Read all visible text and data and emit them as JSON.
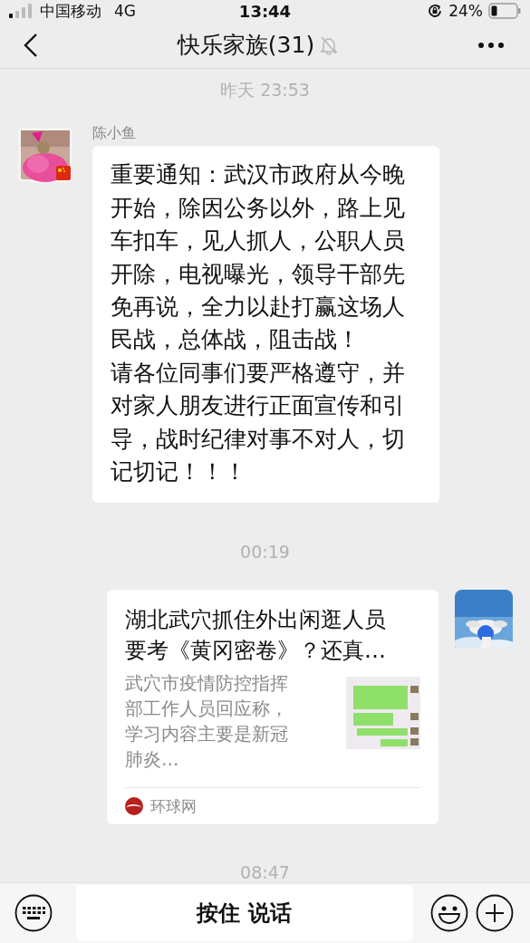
{
  "status_bar": {
    "carrier": "中国移动",
    "network": "4G",
    "time": "13:44",
    "battery": "24%"
  },
  "header": {
    "title": "快乐家族(31)",
    "muted": true
  },
  "messages": [
    {
      "kind": "time",
      "text": "昨天 23:53"
    },
    {
      "kind": "text",
      "sender": "陈小鱼",
      "paragraphs": [
        "重要通知：武汉市政府从今晚开始，除因公务以外，路上见车扣车，见人抓人，公职人员开除，电视曝光，领导干部先免再说，全力以赴打赢这场人民战，总体战，阻击战！",
        "请各位同事们要严格遵守，并对家人朋友进行正面宣传和引导，战时纪律对事不对人，切记切记！！！"
      ]
    },
    {
      "kind": "time",
      "text": "00:19"
    },
    {
      "kind": "link",
      "title": "湖北武穴抓住外出闲逛人员要考《黄冈密卷》？还真…",
      "description": "武穴市疫情防控指挥部工作人员回应称，学习内容主要是新冠肺炎…",
      "source": "环球网"
    },
    {
      "kind": "time",
      "text": "08:47"
    }
  ],
  "input_bar": {
    "hold_to_talk": "按住 说话"
  }
}
